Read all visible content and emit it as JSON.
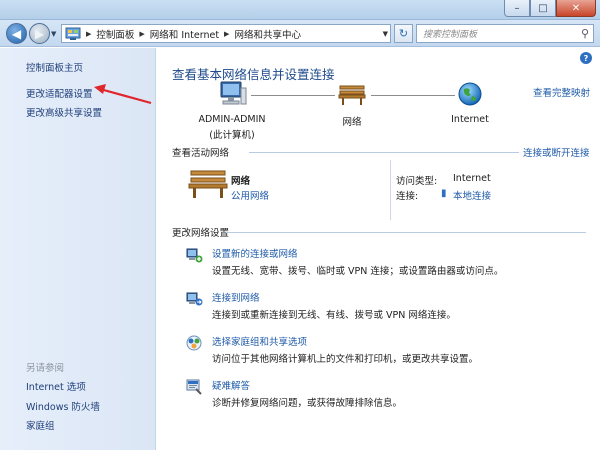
{
  "window": {
    "buttons": {
      "minimize": "–",
      "maximize": "□",
      "close": "✕"
    }
  },
  "address": {
    "breadcrumbs": [
      "控制面板",
      "网络和 Internet",
      "网络和共享中心"
    ],
    "search_placeholder": "搜索控制面板"
  },
  "sidebar": {
    "home": "控制面板主页",
    "items": [
      "更改适配器设置",
      "更改高级共享设置"
    ],
    "see_also_label": "另请参阅",
    "see_also": [
      "Internet 选项",
      "Windows 防火墙",
      "家庭组"
    ]
  },
  "main": {
    "heading": "查看基本网络信息并设置连接",
    "view_full_map": "查看完整映射",
    "map": {
      "computer": "ADMIN-ADMIN",
      "computer_sub": "(此计算机)",
      "network": "网络",
      "internet": "Internet"
    },
    "active": {
      "title": "查看活动网络",
      "connect_link": "连接或断开连接",
      "network_name": "网络",
      "network_type": "公用网络",
      "access_type_label": "访问类型:",
      "access_type_value": "Internet",
      "connection_label": "连接:",
      "connection_value": "本地连接"
    },
    "settings": {
      "title": "更改网络设置",
      "tasks": [
        {
          "title": "设置新的连接或网络",
          "desc": "设置无线、宽带、拨号、临时或 VPN 连接；或设置路由器或访问点。"
        },
        {
          "title": "连接到网络",
          "desc": "连接到或重新连接到无线、有线、拨号或 VPN 网络连接。"
        },
        {
          "title": "选择家庭组和共享选项",
          "desc": "访问位于其他网络计算机上的文件和打印机，或更改共享设置。"
        },
        {
          "title": "疑难解答",
          "desc": "诊断并修复网络问题，或获得故障排除信息。"
        }
      ]
    }
  },
  "colors": {
    "link": "#1e5aa8",
    "heading": "#1e4a8c",
    "annotation_arrow": "#e0262d"
  }
}
